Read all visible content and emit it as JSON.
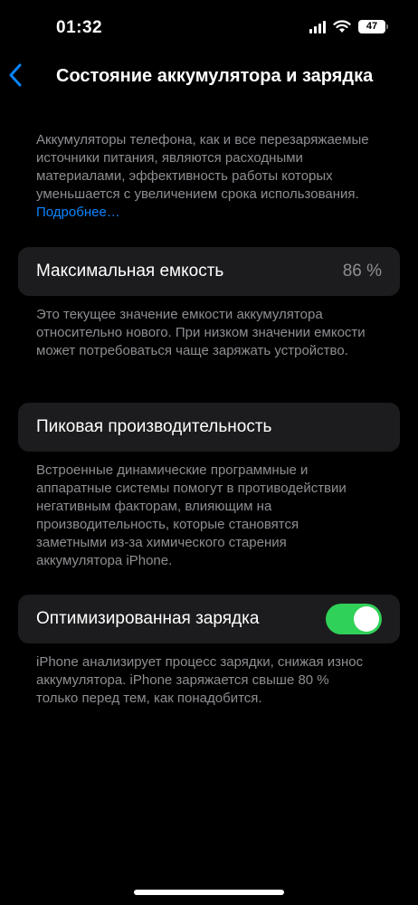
{
  "status_bar": {
    "time": "01:32",
    "battery_level": "47"
  },
  "nav": {
    "title": "Состояние аккумулятора и зарядка"
  },
  "intro": {
    "text": "Аккумуляторы телефона, как и все переза­ряжаемые источники питания, являются расходными материалами, эффективность работы которых уменьшается с увеличением срока использования. ",
    "link": "Подробнее…"
  },
  "max_capacity": {
    "label": "Максимальная емкость",
    "value": "86 %",
    "description": "Это текущее значение емкости аккумулятора относительно нового. При низком значении емкости может потребоваться чаще заряжать устройство."
  },
  "peak_performance": {
    "label": "Пиковая производительность",
    "description": "Встроенные динамические программные и аппаратные системы помогут в противодей­ствии негативным факторам, влияющим на производительность, которые становятся заметными из-за химического старения аккумулятора iPhone."
  },
  "optimized_charging": {
    "label": "Оптимизированная зарядка",
    "enabled": true,
    "description": "iPhone анализирует процесс зарядки, снижая износ аккумулятора. iPhone заряжается свыше 80 % только перед тем, как понадобится."
  },
  "colors": {
    "background": "#000000",
    "card": "#1c1c1e",
    "secondary_text": "#8e8e93",
    "accent": "#0a84ff",
    "toggle_on": "#30d158"
  }
}
